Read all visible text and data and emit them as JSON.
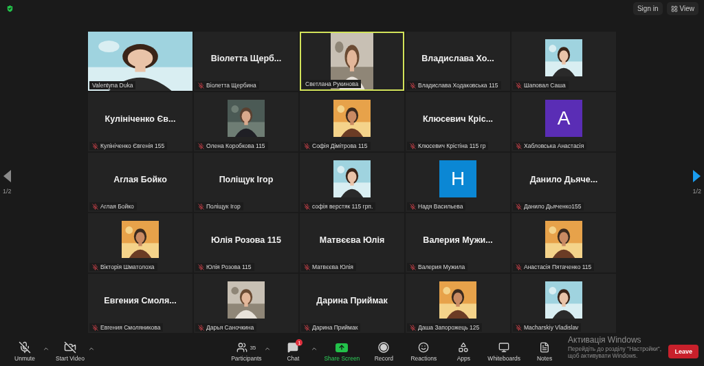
{
  "top_bar": {
    "sign_in": "Sign in",
    "view": "View"
  },
  "pager_left": {
    "page": "1/2",
    "disabled": true
  },
  "pager_right": {
    "page": "1/2",
    "disabled": false
  },
  "tiles": [
    {
      "kind": "video",
      "name": "Valentyna Duka",
      "muted": false,
      "speaking": false
    },
    {
      "kind": "name",
      "display": "Віолетта Щерб...",
      "name": "Віолетта Щербина",
      "muted": true,
      "speaking": false
    },
    {
      "kind": "portrait",
      "name": "Светлана Рукинова",
      "muted": false,
      "speaking": true
    },
    {
      "kind": "name",
      "display": "Владислава Хо...",
      "name": "Владислава Ходаковська 115",
      "muted": true,
      "speaking": false
    },
    {
      "name": "Шаповал Саша",
      "muted": true,
      "speaking": false
    },
    {
      "kind": "name",
      "display": "Кулініченко Єв...",
      "name": "Кулініченко Євгенія 155",
      "muted": true,
      "speaking": false
    },
    {
      "name": "Олена Коробкова 115",
      "muted": true,
      "speaking": false
    },
    {
      "name": "Софія Дімітрова 115",
      "muted": true,
      "speaking": false
    },
    {
      "kind": "name",
      "display": "Клюсевич Кріс...",
      "name": "Клюсевич Крістіна 115 гр",
      "muted": true,
      "speaking": false
    },
    {
      "kind": "avatar",
      "letter": "A",
      "color": "#5a2db5",
      "name": "Хабловська Анастасія",
      "muted": true,
      "speaking": false
    },
    {
      "kind": "name",
      "display": "Аглая Бойко",
      "name": "Аглая Бойко",
      "muted": true,
      "speaking": false
    },
    {
      "kind": "name",
      "display": "Поліщук Ігор",
      "name": "Поліщук Ігор",
      "muted": true,
      "speaking": false
    },
    {
      "name": "софія верстяк 115 грп.",
      "muted": true,
      "speaking": false
    },
    {
      "kind": "avatar",
      "letter": "H",
      "color": "#0b87d4",
      "name": "Надя Васильева",
      "muted": true,
      "speaking": false
    },
    {
      "kind": "name",
      "display": "Данило Дьяче...",
      "name": "Данило Дьяченко155",
      "muted": true,
      "speaking": false
    },
    {
      "name": "Вікторія Шматолоха",
      "muted": true,
      "speaking": false
    },
    {
      "kind": "name",
      "display": "Юлія Розова 115",
      "name": "Юлія Розова 115",
      "muted": true,
      "speaking": false
    },
    {
      "kind": "name",
      "display": "Матвєєва Юлія",
      "name": "Матвєєва Юлія",
      "muted": true,
      "speaking": false
    },
    {
      "kind": "name",
      "display": "Валерия Мужи...",
      "name": "Валерия Мужила",
      "muted": true,
      "speaking": false
    },
    {
      "name": "Анастасія Пятаченко 115",
      "muted": true,
      "speaking": false
    },
    {
      "kind": "name",
      "display": "Евгения Смоля...",
      "name": "Евгения Смоляникова",
      "muted": true,
      "speaking": false
    },
    {
      "name": "Дарья Саночкина",
      "muted": true,
      "speaking": false
    },
    {
      "kind": "name",
      "display": "Дарина Приймак",
      "name": "Дарина Приймак",
      "muted": true,
      "speaking": false
    },
    {
      "name": "Даша Запорожець 125",
      "muted": true,
      "speaking": false
    },
    {
      "name": "Macharskiy Vladislav",
      "muted": true,
      "speaking": false
    }
  ],
  "toolbar_left": [
    {
      "kind": "mic",
      "label": "Unmute",
      "menu": true
    },
    {
      "kind": "video",
      "label": "Start Video",
      "menu": true
    }
  ],
  "toolbar_center": [
    {
      "kind": "participants",
      "label": "Participants",
      "count": "35",
      "menu": true
    },
    {
      "kind": "chat",
      "label": "Chat",
      "badge": "1",
      "menu": true
    },
    {
      "kind": "share",
      "label": "Share Screen",
      "menu": false
    },
    {
      "kind": "record",
      "label": "Record",
      "menu": false
    },
    {
      "kind": "reactions",
      "label": "Reactions",
      "menu": false
    },
    {
      "kind": "apps",
      "label": "Apps",
      "menu": false
    },
    {
      "kind": "whiteboards",
      "label": "Whiteboards",
      "menu": false
    },
    {
      "kind": "notes",
      "label": "Notes",
      "menu": false
    }
  ],
  "leave": "Leave",
  "windows_notice": {
    "title": "Активація Windows",
    "text": "Перейдіть до розділу \"Настройки\", щоб активувати Windows."
  }
}
